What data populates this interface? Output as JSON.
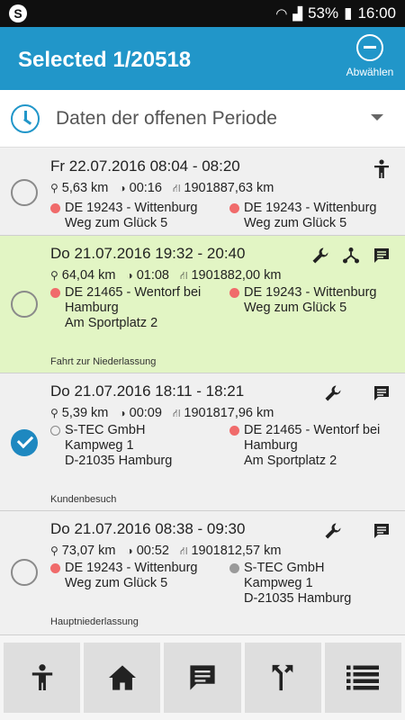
{
  "statusbar": {
    "battery": "53%",
    "time": "16:00"
  },
  "appbar": {
    "title": "Selected 1/20518",
    "deselect_label": "Abwählen"
  },
  "period": {
    "label": "Daten der offenen Periode"
  },
  "trips": [
    {
      "when": "Fr 22.07.2016 08:04 - 08:20",
      "distance": "5,63 km",
      "duration": "00:16",
      "odometer": "1901887,63 km",
      "from": [
        "DE 19243 - Wittenburg",
        "Weg zum Glück 5"
      ],
      "to": [
        "DE 19243 - Wittenburg",
        "Weg zum Glück 5"
      ],
      "note": ""
    },
    {
      "when": "Do 21.07.2016 19:32 - 20:40",
      "distance": "64,04 km",
      "duration": "01:08",
      "odometer": "1901882,00 km",
      "from": [
        "DE 21465 - Wentorf bei",
        "Hamburg",
        "Am Sportplatz 2"
      ],
      "to": [
        "DE 19243 - Wittenburg",
        "Weg zum Glück 5"
      ],
      "note": "Fahrt zur Niederlassung"
    },
    {
      "when": "Do 21.07.2016 18:11 - 18:21",
      "distance": "5,39 km",
      "duration": "00:09",
      "odometer": "1901817,96 km",
      "from": [
        "S-TEC GmbH",
        "Kampweg 1",
        "D-21035 Hamburg"
      ],
      "to": [
        "DE 21465 - Wentorf bei",
        "Hamburg",
        "Am Sportplatz 2"
      ],
      "note": "Kundenbesuch"
    },
    {
      "when": "Do 21.07.2016 08:38 - 09:30",
      "distance": "73,07 km",
      "duration": "00:52",
      "odometer": "1901812,57 km",
      "from": [
        "DE 19243 - Wittenburg",
        "Weg zum Glück 5"
      ],
      "to": [
        "S-TEC GmbH",
        "Kampweg 1",
        "D-21035 Hamburg"
      ],
      "note": "Hauptniederlassung"
    }
  ],
  "bottomnav": [
    "person-icon",
    "home-icon",
    "comment-icon",
    "route-icon",
    "list-icon"
  ],
  "colors": {
    "primary": "#2196c9",
    "selected_bg": "#e2f5c4",
    "marker_red": "#f06b6b"
  }
}
